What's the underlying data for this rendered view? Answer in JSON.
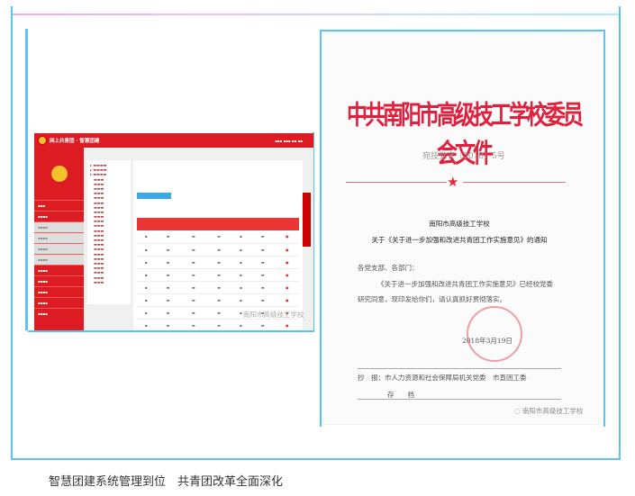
{
  "caption": "智慧团建系统管理到位　共青团改革全面深化",
  "screenshot": {
    "app_title": "网上共青团 · 智慧团建",
    "watermark": "南阳市高级技工学校",
    "colors": {
      "header": "#dc1c22",
      "button": "#3aa9e8"
    }
  },
  "document": {
    "title": "中共南阳市高级技工学校委员会文件",
    "doc_number": "宛技党字〔2018〕5号",
    "school": "南阳市高级技工学校",
    "subject": "关于《关于进一步加强和改进共青团工作实施意见》的通知",
    "salutation": "各党支部、各部门：",
    "body_line1": "《关于进一步加强和改进共青团工作实施意见》已经校党委",
    "body_line2": "研究同意，现印发给你们，请认真抓好贯彻落实。",
    "date": "2018年3月19日",
    "cc_label": "抄　报：",
    "cc": "市人力资源和社会保障局机关党委　市直团工委",
    "archive": "存　　档",
    "watermark": "南阳市高级技工学校",
    "colors": {
      "title": "#e0203c"
    }
  }
}
